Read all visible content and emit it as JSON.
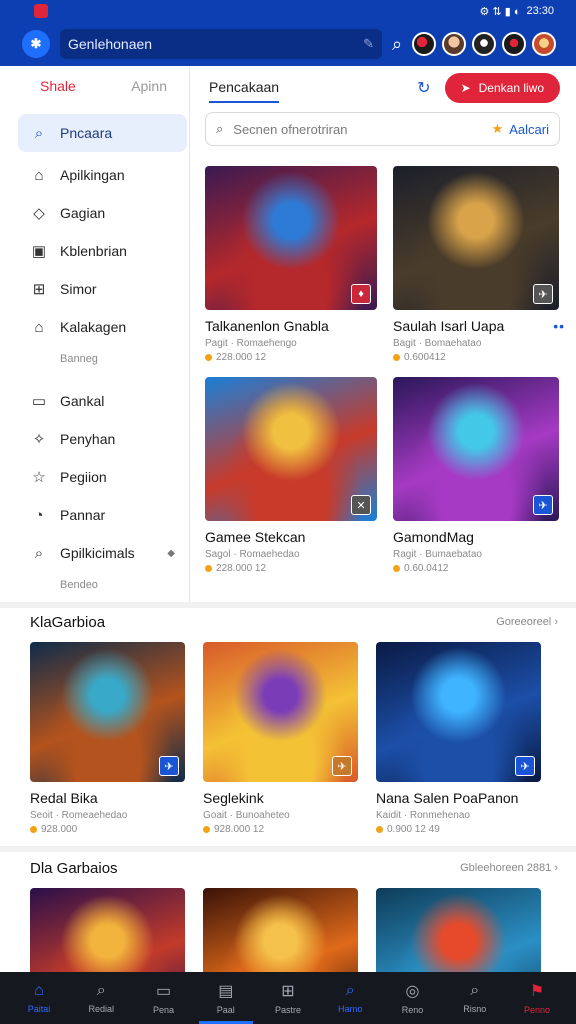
{
  "status_bar": {
    "time": "23:30",
    "icons": "⚙ ⇅ ▮ ◐"
  },
  "app_bar": {
    "search_text": "Genlehonaen",
    "mic_icon": "mic-icon"
  },
  "sidebar": {
    "tabs": [
      {
        "label": "Shale"
      },
      {
        "label": "Apinn"
      }
    ],
    "items": [
      {
        "label": "Pncaara",
        "icon": "⌕"
      },
      {
        "label": "Apilkingan",
        "icon": "⌂"
      },
      {
        "label": "Gagian",
        "icon": "◇"
      },
      {
        "label": "Kblenbrian",
        "icon": "▣"
      },
      {
        "label": "Simor",
        "icon": "⊞"
      },
      {
        "label": "Kalakagen",
        "icon": "⌂"
      },
      {
        "label": "Gankal",
        "icon": "▭"
      },
      {
        "label": "Penyhan",
        "icon": "✧"
      },
      {
        "label": "Pegiion",
        "icon": "☆"
      },
      {
        "label": "Pannar",
        "icon": "◔"
      },
      {
        "label": "Gpilkicimals",
        "icon": "⌕"
      }
    ],
    "subs": [
      "Banneg",
      "Bendeo"
    ]
  },
  "main": {
    "tab": "Pencakaan",
    "button_label": "Denkan liwo",
    "search_placeholder": "Secnen ofnerotriran",
    "search_pill": "Aalcari",
    "cards": [
      {
        "title": "Talkanenlon Gnabla",
        "sub": "Pagit · Romaehengo",
        "meta": "228.000 12",
        "colors": [
          "#3a1a52",
          "#b5282b",
          "#2d7bd6"
        ]
      },
      {
        "title": "Saulah Isarl Uapa",
        "sub": "Bagit · Bomaehatao",
        "meta": "0.600412",
        "colors": [
          "#1b1f2a",
          "#4a3c2a",
          "#d9a34a"
        ]
      },
      {
        "title": "Gamee Stekcan",
        "sub": "Sagol · Romaehedao",
        "meta": "228.000 12",
        "colors": [
          "#1a7fd8",
          "#c83a2a",
          "#f0c040"
        ]
      },
      {
        "title": "GamondMag",
        "sub": "Ragit · Bumaebatao",
        "meta": "0.60.0412",
        "colors": [
          "#2a1758",
          "#a63ac4",
          "#43c8e8"
        ]
      }
    ]
  },
  "section1": {
    "title": "KlaGarbioa",
    "link": "Goreeoreel",
    "cards": [
      {
        "title": "Redal Bika",
        "sub": "Seoit · Romeaehedao",
        "meta": "928.000",
        "colors": [
          "#0f2c4a",
          "#b4531d",
          "#38a9c9"
        ]
      },
      {
        "title": "Seglekink",
        "sub": "Goait · Bunoaheteo",
        "meta": "928.000 12",
        "colors": [
          "#d85a2a",
          "#f4c235",
          "#7b3cb8"
        ]
      },
      {
        "title": "Nana Salen PoaPanon",
        "sub": "Kaidit · Ronmehenao",
        "meta": "0.900 12 49",
        "colors": [
          "#0a1a44",
          "#1c4fa8",
          "#3fb4ff"
        ]
      }
    ]
  },
  "section2": {
    "title": "Dla Garbaios",
    "link": "Gbleehoreen 2881",
    "cards": [
      {
        "colors": [
          "#2b0f4a",
          "#c23b2a",
          "#f2b43c"
        ]
      },
      {
        "colors": [
          "#3a1208",
          "#e06a1a",
          "#f4c24a"
        ]
      },
      {
        "colors": [
          "#0e3c58",
          "#2b8fc4",
          "#e64a2a"
        ]
      }
    ]
  },
  "bottom_nav": [
    {
      "label": "Paitai",
      "icon": "⌂",
      "state": "active"
    },
    {
      "label": "Redial",
      "icon": "⌕",
      "state": ""
    },
    {
      "label": "Pena",
      "icon": "▭",
      "state": ""
    },
    {
      "label": "Paal",
      "icon": "▤",
      "state": "home"
    },
    {
      "label": "Pastre",
      "icon": "⊞",
      "state": ""
    },
    {
      "label": "Harno",
      "icon": "⌕",
      "state": "active"
    },
    {
      "label": "Reno",
      "icon": "◎",
      "state": ""
    },
    {
      "label": "Risno",
      "icon": "⌕",
      "state": ""
    },
    {
      "label": "Penno",
      "icon": "⚑",
      "state": "red"
    }
  ]
}
